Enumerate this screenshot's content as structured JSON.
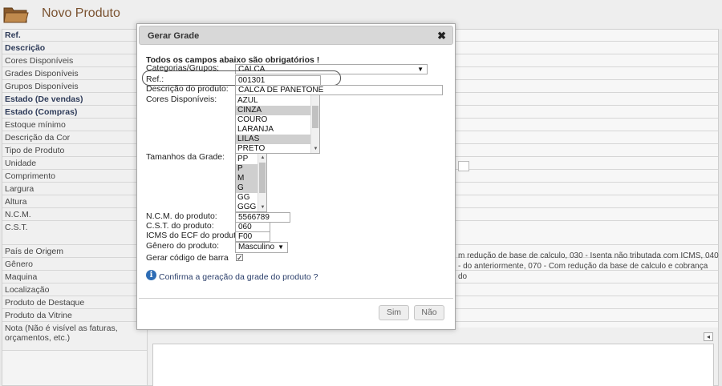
{
  "header": {
    "title": "Novo Produto",
    "icon": "folder-icon"
  },
  "background_form": {
    "rows": [
      {
        "label": "Ref.",
        "bold": true
      },
      {
        "label": "Descrição",
        "bold": true
      },
      {
        "label": "Cores Disponíveis",
        "bold": false
      },
      {
        "label": "Grades Disponíveis",
        "bold": false
      },
      {
        "label": "Grupos Disponíveis",
        "bold": false
      },
      {
        "label": "Estado (De vendas)",
        "bold": true
      },
      {
        "label": "Estado (Compras)",
        "bold": true
      },
      {
        "label": "Estoque mínimo",
        "bold": false
      },
      {
        "label": "Descrição da Cor",
        "bold": false
      },
      {
        "label": "Tipo de Produto",
        "bold": false
      },
      {
        "label": "Unidade",
        "bold": false
      },
      {
        "label": "Comprimento",
        "bold": false
      },
      {
        "label": "Largura",
        "bold": false
      },
      {
        "label": "Altura",
        "bold": false
      },
      {
        "label": "N.C.M.",
        "bold": false
      },
      {
        "label": "C.S.T.",
        "bold": false
      },
      {
        "label": "País de Origem",
        "bold": false
      },
      {
        "label": "Gênero",
        "bold": false
      },
      {
        "label": "Maquina",
        "bold": false
      },
      {
        "label": "Localização",
        "bold": false
      },
      {
        "label": "Produto de Destaque",
        "bold": false
      },
      {
        "label": "Produto da Vitrine",
        "bold": false
      },
      {
        "label": "Nota (Não é visível as faturas, orçamentos, etc.)",
        "bold": false
      }
    ],
    "cst_text": "m redução de base de calculo, 030 - Isenta não tributada com ICMS, 040 - do anteriormente, 070 - Com redução da base de calculo e cobrança do"
  },
  "dialog": {
    "title": "Gerar Grade",
    "close_glyph": "✖",
    "heading": "Todos os campos abaixo são obrigatórios !",
    "categorias_label": "Categorias/Grupos:",
    "categorias_value": "CALCA",
    "ref_label": "Ref.:",
    "ref_value": "001301",
    "descricao_label": "Descrição do produto:",
    "descricao_value": "CALCA DE PANETONE",
    "cores_label": "Cores Disponíveis:",
    "cores": [
      {
        "name": "AZUL",
        "selected": false
      },
      {
        "name": "CINZA",
        "selected": true
      },
      {
        "name": "COURO",
        "selected": false
      },
      {
        "name": "LARANJA",
        "selected": false
      },
      {
        "name": "LILAS",
        "selected": true
      },
      {
        "name": "PRETO",
        "selected": false
      }
    ],
    "tamanhos_label": "Tamanhos da Grade:",
    "tamanhos": [
      {
        "name": "PP",
        "selected": false
      },
      {
        "name": "P",
        "selected": true
      },
      {
        "name": "M",
        "selected": true
      },
      {
        "name": "G",
        "selected": true
      },
      {
        "name": "GG",
        "selected": false
      },
      {
        "name": "GGG",
        "selected": false
      }
    ],
    "ncm_label": "N.C.M. do produto:",
    "ncm_value": "5566789",
    "cst_label": "C.S.T. do produto:",
    "cst_value": "060",
    "icms_label": "ICMS do ECF do produto:",
    "icms_value": "F00",
    "genero_label": "Gênero do produto:",
    "genero_value": "Masculino",
    "barcode_label": "Gerar código de barra",
    "barcode_checked": true,
    "confirm_text": "Confirma a geração da grade do produto ?",
    "yes_label": "Sim",
    "no_label": "Não"
  },
  "colors": {
    "title_brown": "#7a5230",
    "info_blue": "#2d6cb5",
    "label_navy": "#2f3c5a"
  }
}
